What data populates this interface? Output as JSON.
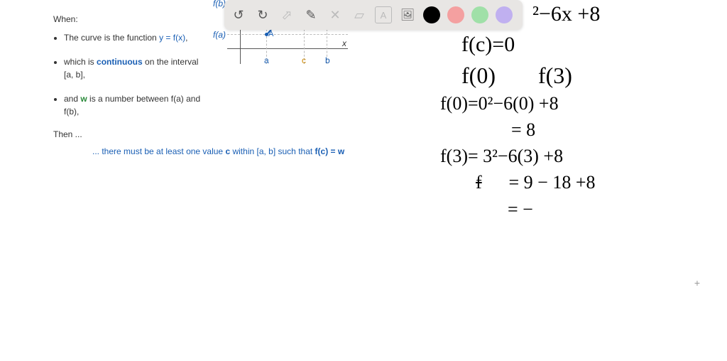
{
  "left": {
    "when": "When:",
    "b1_a": "The curve is the function ",
    "b1_b": "y = f(x)",
    "b1_c": ",",
    "b2_a": "which is ",
    "b2_b": "continuous",
    "b2_c": " on the interval [a, b],",
    "b3_a": "and ",
    "b3_b": "w",
    "b3_c": " is a number between f(a) and f(b),",
    "then": "Then ...",
    "conc_a": "... there must be at least one value ",
    "conc_b": "c",
    "conc_c": " within [a, b] such that ",
    "conc_d": "f(c) = w"
  },
  "graph": {
    "fb": "f(b)",
    "fa": "f(a)",
    "A": "A",
    "a": "a",
    "c": "c",
    "b": "b",
    "x": "x"
  },
  "toolbar": {
    "undo": "↺",
    "redo": "↻",
    "cursor": "⬀",
    "pen": "✎",
    "tools": "✕",
    "eraser": "▱",
    "text": "A",
    "image": "🖼"
  },
  "hand": {
    "l1": "²−6x +8",
    "l2": "f(c)=0",
    "l3a": "f(0)",
    "l3b": "f(3)",
    "l4": "f(0)=0²−6(0) +8",
    "l5": "= 8",
    "l6": "f(3)= 3²−6(3) +8",
    "l7s": "f",
    "l7": "= 9 − 18 +8",
    "l8": "= −"
  }
}
